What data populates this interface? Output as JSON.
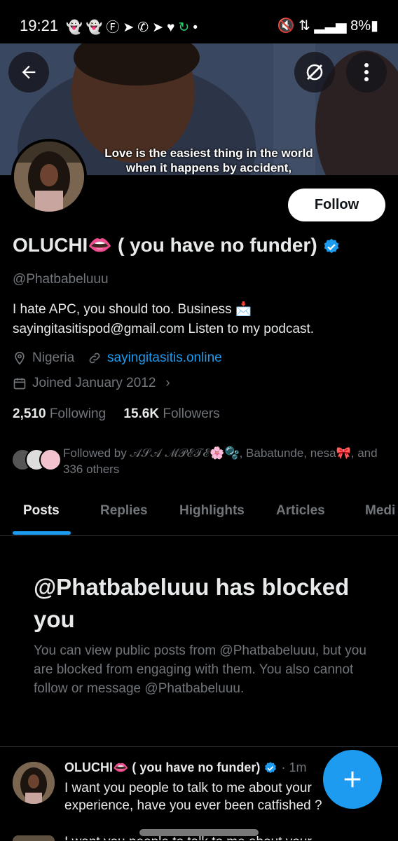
{
  "status_bar": {
    "time": "19:21",
    "left_icons": [
      "snapchat-icon",
      "snapchat-icon",
      "facebook-icon",
      "telegram-icon",
      "whatsapp-icon",
      "telegram-icon",
      "heart-icon",
      "sync-icon",
      "dot-icon"
    ],
    "battery": "8%"
  },
  "banner": {
    "caption_line1": "Love is the easiest thing in the world",
    "caption_line2": "when it happens by accident,"
  },
  "profile": {
    "follow_label": "Follow",
    "name": "OLUCHI👄 ( you have no funder)",
    "handle": "@Phatbabeluuu",
    "bio_line1": "I hate APC, you should too. Business 📩",
    "bio_line2": "sayingitasitispod@gmail.com Listen to my podcast.",
    "location": "Nigeria",
    "website": "sayingitasitis.online",
    "joined": "Joined January 2012",
    "following_count": "2,510",
    "following_label": "Following",
    "followers_count": "15.6K",
    "followers_label": "Followers",
    "followed_by_line1": "Followed by 𝒜𝒮𝒜 ℳ𝒫ℰ𝒯ℰ🌸🫧, Babatunde, nesa🎀, and",
    "followed_by_line2": "336 others"
  },
  "tabs": [
    "Posts",
    "Replies",
    "Highlights",
    "Articles",
    "Medi"
  ],
  "blocked": {
    "title": "@Phatbabeluuu has blocked you",
    "text": "You can view public posts from @Phatbabeluuu, but you are blocked from engaging with them. You also cannot follow or message @Phatbabeluuu."
  },
  "post": {
    "author": "OLUCHI👄 ( you have no funder)",
    "time": "· 1m",
    "text_line1": "I want you people to talk to me about your",
    "text_line2": "experience, have you ever been catfished ?",
    "next_text": "I want you people to talk to me about your"
  },
  "colors": {
    "accent": "#1d9bf0",
    "background": "#000000",
    "secondary_text": "#71767b"
  }
}
